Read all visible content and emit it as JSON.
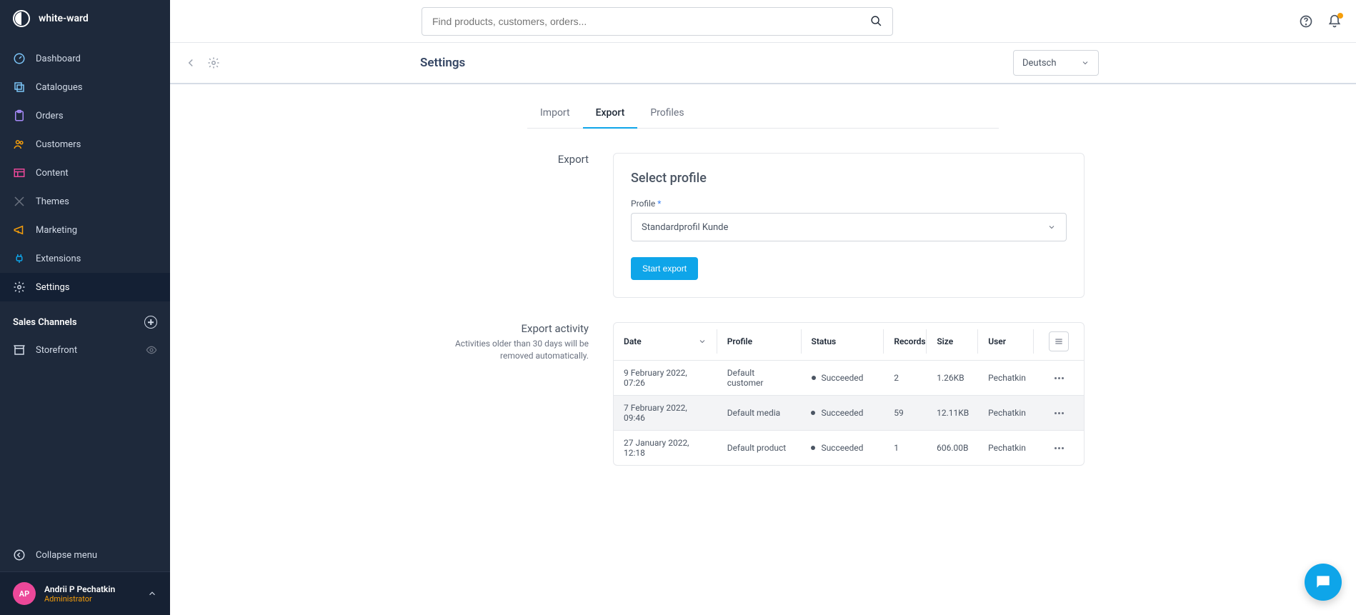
{
  "brand": "white-ward",
  "nav": {
    "dashboard": "Dashboard",
    "catalogues": "Catalogues",
    "orders": "Orders",
    "customers": "Customers",
    "content": "Content",
    "themes": "Themes",
    "marketing": "Marketing",
    "extensions": "Extensions",
    "settings": "Settings"
  },
  "salesChannels": {
    "header": "Sales Channels",
    "storefront": "Storefront"
  },
  "collapse": "Collapse menu",
  "user": {
    "initials": "AP",
    "name": "Andrii P Pechatkin",
    "role": "Administrator"
  },
  "search": {
    "placeholder": "Find products, customers, orders..."
  },
  "page": {
    "title": "Settings",
    "language": "Deutsch"
  },
  "tabs": {
    "import": "Import",
    "export": "Export",
    "profiles": "Profiles"
  },
  "exportSection": {
    "label": "Export",
    "cardTitle": "Select profile",
    "fieldLabel": "Profile",
    "selectedProfile": "Standardprofil Kunde",
    "startButton": "Start export"
  },
  "activitySection": {
    "label": "Export activity",
    "sub": "Activities older than 30 days will be removed automatically.",
    "columns": {
      "date": "Date",
      "profile": "Profile",
      "status": "Status",
      "records": "Records",
      "size": "Size",
      "user": "User"
    },
    "rows": [
      {
        "date": "9 February 2022, 07:26",
        "profile": "Default customer",
        "status": "Succeeded",
        "records": "2",
        "size": "1.26KB",
        "user": "Pechatkin"
      },
      {
        "date": "7 February 2022, 09:46",
        "profile": "Default media",
        "status": "Succeeded",
        "records": "59",
        "size": "12.11KB",
        "user": "Pechatkin"
      },
      {
        "date": "27 January 2022, 12:18",
        "profile": "Default product",
        "status": "Succeeded",
        "records": "1",
        "size": "606.00B",
        "user": "Pechatkin"
      }
    ]
  }
}
